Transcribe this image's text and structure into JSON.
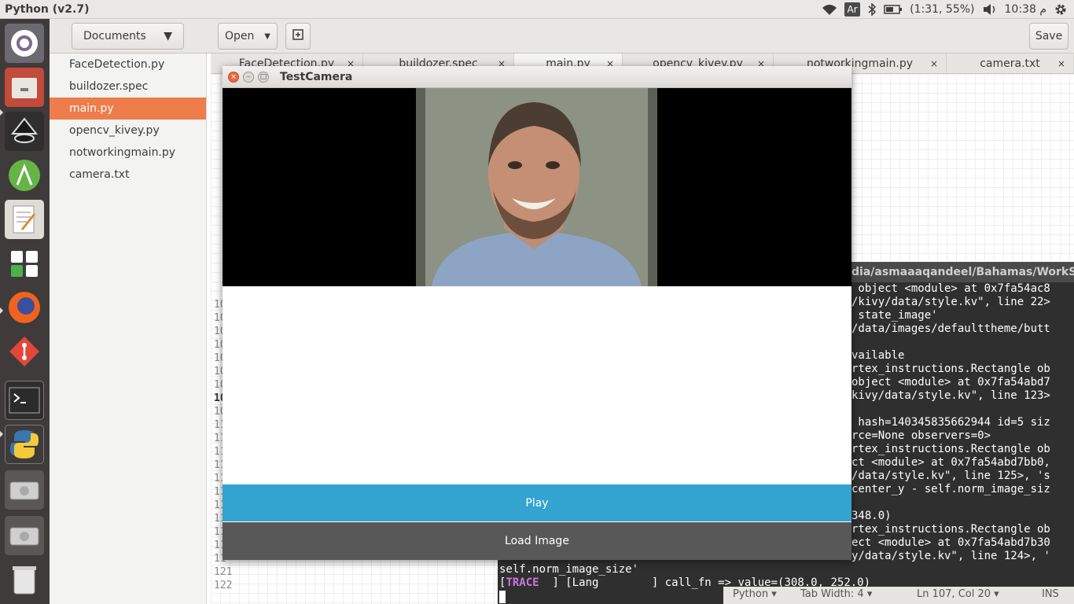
{
  "topbar": {
    "app_title": "Python (v2.7)",
    "keyboard_layout": "Ar",
    "battery": "(1:31, 55%)",
    "clock": "م 10:38"
  },
  "launcher": {
    "items": [
      "ubuntu-dash",
      "files",
      "inkscape",
      "android-studio",
      "text-editor",
      "keyboard",
      "firefox",
      "git",
      "terminal",
      "python",
      "drive",
      "drive",
      "trash"
    ]
  },
  "gedit": {
    "documents_label": "Documents",
    "open_label": "Open",
    "save_label": "Save",
    "sidebar": [
      "FaceDetection.py",
      "buildozer.spec",
      "main.py",
      "opencv_kivey.py",
      "notworkingmain.py",
      "camera.txt"
    ],
    "active_doc": "main.py",
    "tabs": [
      "FaceDetection.py",
      "buildozer.spec",
      "main.py",
      "opencv_kivey.py",
      "notworkingmain.py",
      "camera.txt"
    ],
    "gutter": [
      "10",
      "10",
      "10",
      "10",
      "10",
      "10",
      "10",
      "10",
      "10",
      "11",
      "11",
      "11",
      "11",
      "11",
      "11",
      "11",
      "11",
      "11",
      "11",
      "11",
      "121",
      "122"
    ]
  },
  "terminal": {
    "title": "dia/asmaaaqandeel/Bahamas/WorkSp",
    "lines": [
      " object <module> at 0x7fa54ac8",
      "/kivy/data/style.kv\", line 22>",
      " state_image'",
      "/data/images/defaulttheme/butt",
      "",
      "vailable",
      "rtex_instructions.Rectangle ob",
      "object <module> at 0x7fa54abd7",
      "kivy/data/style.kv\", line 123>",
      "",
      " hash=140345835662944 id=5 siz",
      "rce=None observers=0>",
      "rtex_instructions.Rectangle ob",
      "ct <module> at 0x7fa54abd7bb0,",
      "/data/style.kv\", line 125>, 's",
      "center_y - self.norm_image_siz",
      "",
      "348.0)",
      "rtex_instructions.Rectangle ob",
      "ect <module> at 0x7fa54abd7b30",
      "y/data/style.kv\", line 124>, '"
    ],
    "line_norm": "self.norm_image_size'",
    "trace_tag": "TRACE",
    "trace_rest": "  ] [Lang        ] call_fn => value=(308.0, 252.0)"
  },
  "statusbar": {
    "language": "Python",
    "tab_width": "Tab Width: 4",
    "position": "Ln 107, Col 20",
    "mode": "INS"
  },
  "camera_window": {
    "title": "TestCamera",
    "play_label": "Play",
    "load_label": "Load Image"
  },
  "colors": {
    "accent_orange": "#ef7c4b",
    "play_blue": "#33a3d0",
    "load_gray": "#585858",
    "launcher_bg": "#3e3b3a"
  }
}
